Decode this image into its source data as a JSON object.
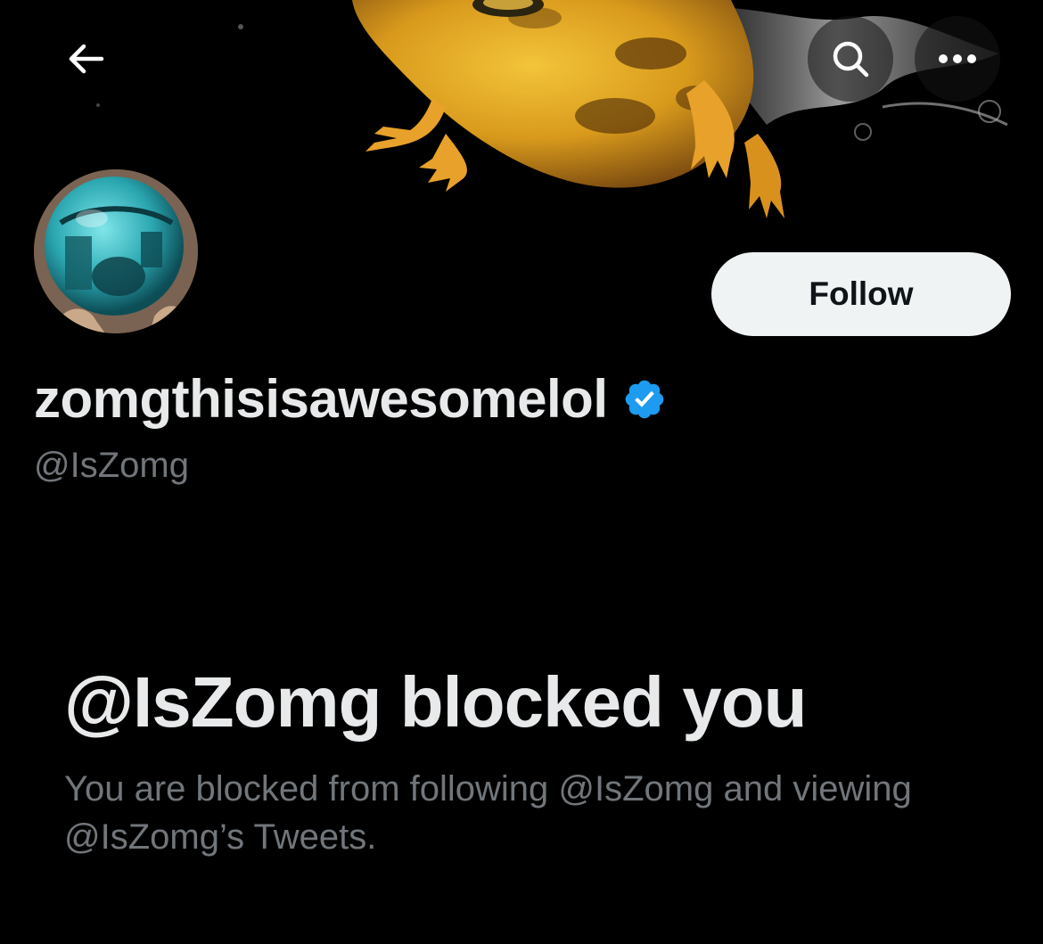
{
  "header": {
    "back_icon": "arrow-left-icon",
    "search_icon": "search-icon",
    "more_icon": "more-horizontal-icon"
  },
  "banner": {
    "description_icon": "frog-banner-image"
  },
  "profile": {
    "display_name": "zomgthisisawesomelol",
    "handle": "@IsZomg",
    "verified": true,
    "verified_icon": "verified-badge-icon",
    "follow_label": "Follow"
  },
  "blocked": {
    "title": "@IsZomg blocked you",
    "description": "You are blocked from following @IsZomg and viewing @IsZomg’s Tweets."
  },
  "colors": {
    "background": "#000000",
    "primary_text": "#e7e9ea",
    "secondary_text": "#71767b",
    "follow_button_bg": "#eff3f4",
    "verified_blue": "#1d9bf0"
  }
}
